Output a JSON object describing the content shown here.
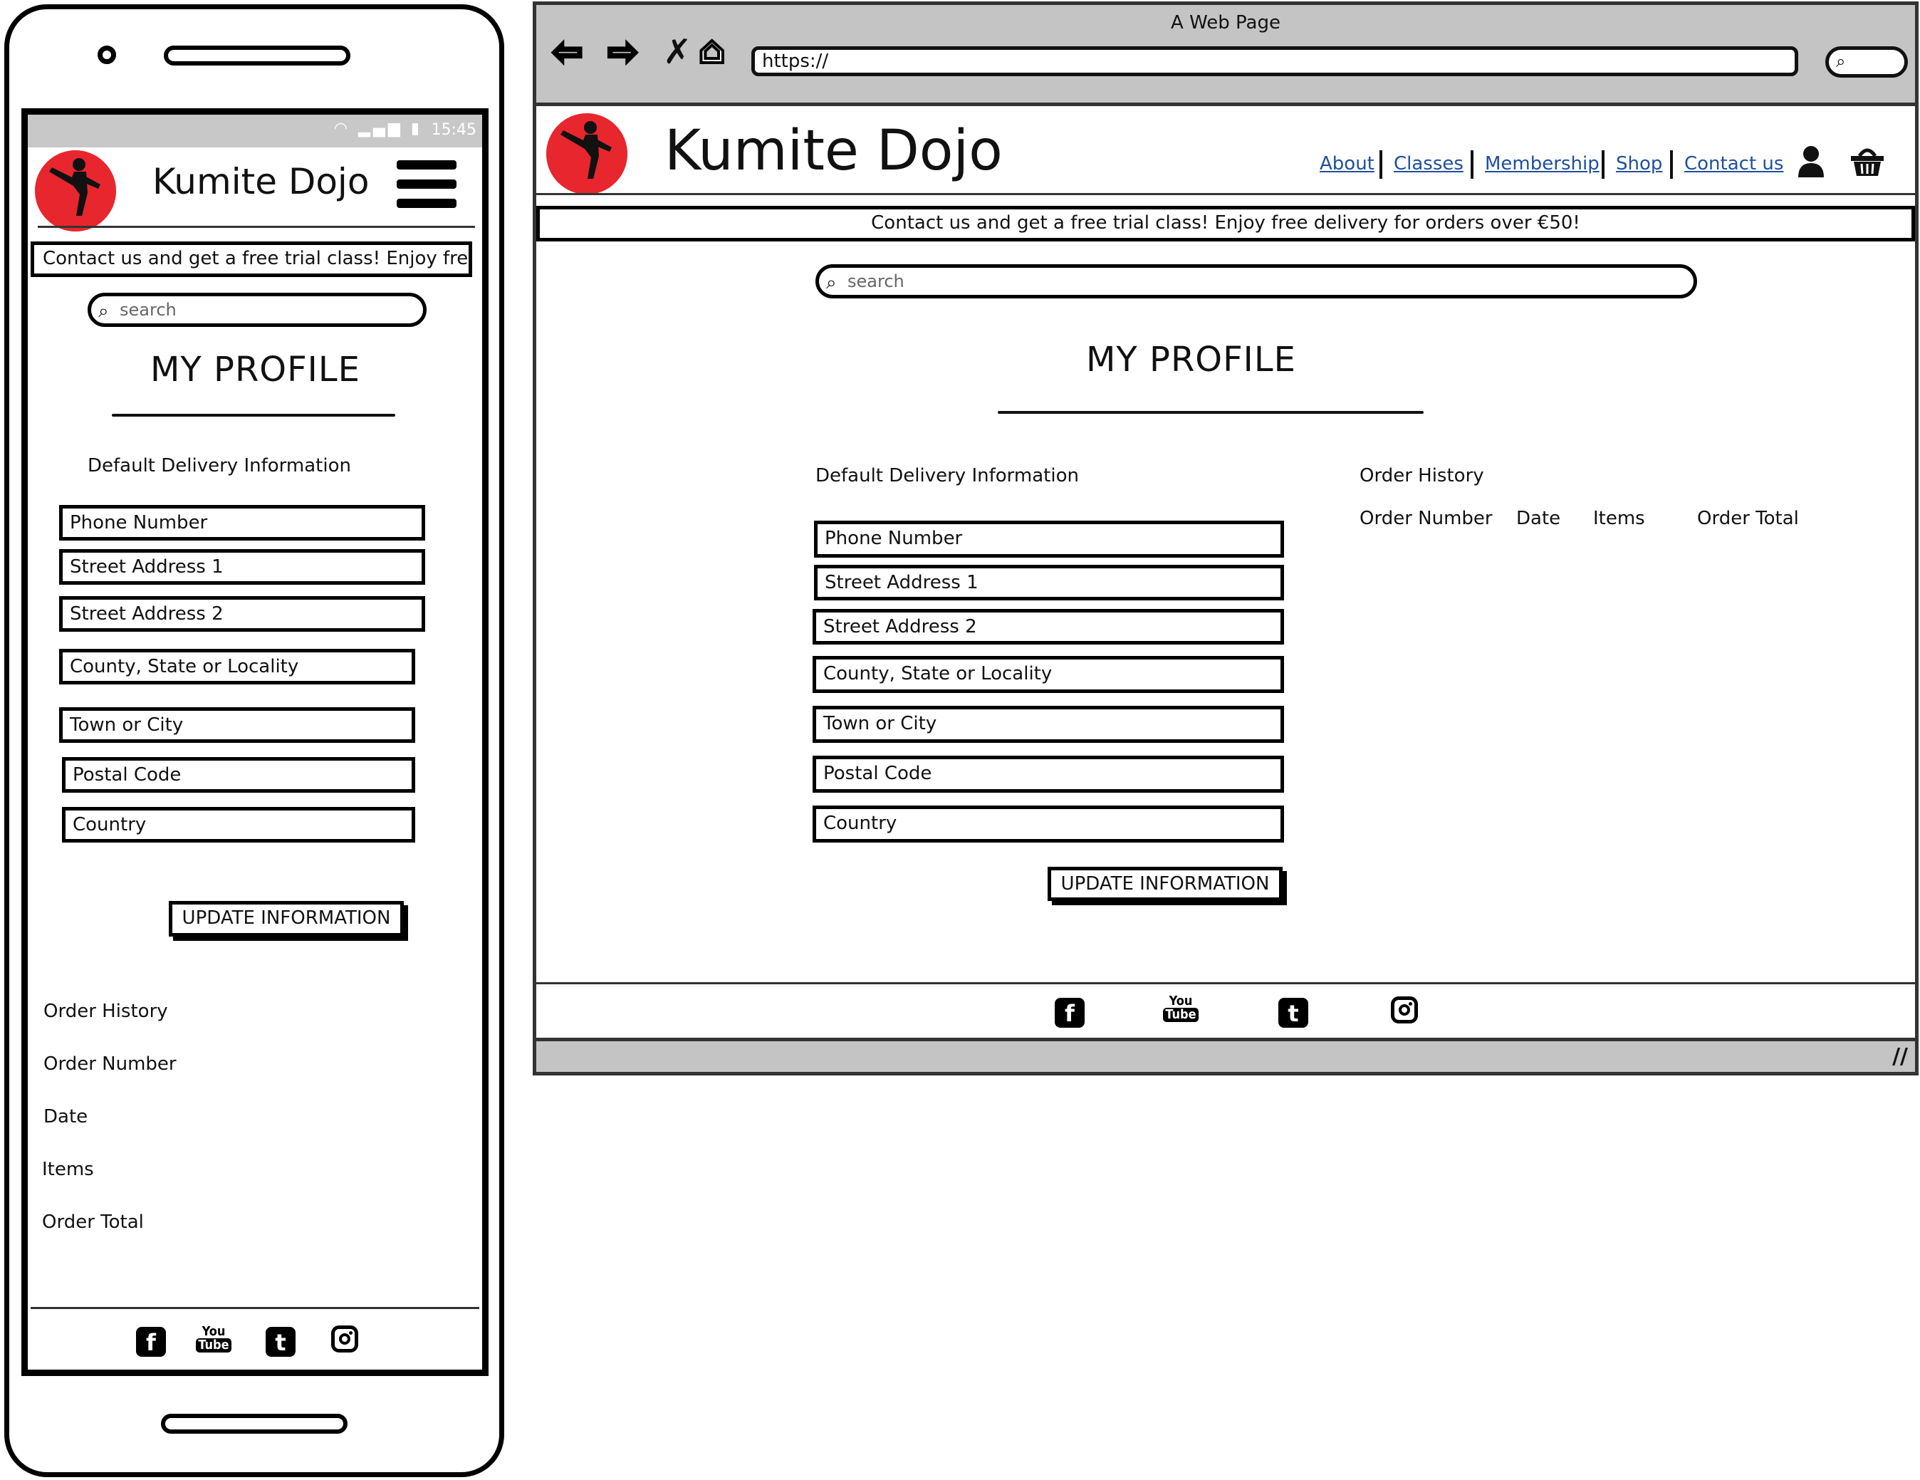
{
  "mobile": {
    "status": {
      "time": "15:45",
      "icons": "wifi signal battery"
    },
    "brand": "Kumite Dojo",
    "banner": "Contact us and get a free trial class! Enjoy free del",
    "search_placeholder": "search",
    "page_heading": "MY PROFILE",
    "delivery_heading": "Default Delivery Information",
    "fields": [
      "Phone Number",
      "Street Address 1",
      "Street Address 2",
      "County, State or Locality",
      "Town or City",
      "Postal Code",
      "Country"
    ],
    "update_button": "UPDATE INFORMATION",
    "order_history": {
      "heading": "Order History",
      "columns": [
        "Order Number",
        "Date",
        "Items",
        "Order Total"
      ]
    },
    "social": {
      "facebook": "f",
      "youtube_top": "You",
      "youtube_bottom": "Tube",
      "twitter": "t"
    }
  },
  "browser": {
    "window_title": "A Web Page",
    "url": "https://",
    "brand": "Kumite Dojo",
    "nav": [
      "About",
      "Classes",
      "Membership",
      "Shop",
      "Contact us"
    ],
    "banner": "Contact us and get a free trial class! Enjoy free delivery for orders over €50!",
    "search_placeholder": "search",
    "page_heading": "MY PROFILE",
    "delivery_heading": "Default Delivery Information",
    "fields": [
      "Phone Number",
      "Street Address 1",
      "Street Address 2",
      "County, State or Locality",
      "Town or City",
      "Postal Code",
      "Country"
    ],
    "update_button": "UPDATE INFORMATION",
    "order_history": {
      "heading": "Order History",
      "columns": [
        "Order Number",
        "Date",
        "Items",
        "Order Total"
      ]
    },
    "social": {
      "facebook": "f",
      "youtube_top": "You",
      "youtube_bottom": "Tube",
      "twitter": "t"
    }
  },
  "colors": {
    "logo_red": "#e8262e",
    "link_blue": "#1f4fa0",
    "chrome_gray": "#c4c4c4"
  }
}
